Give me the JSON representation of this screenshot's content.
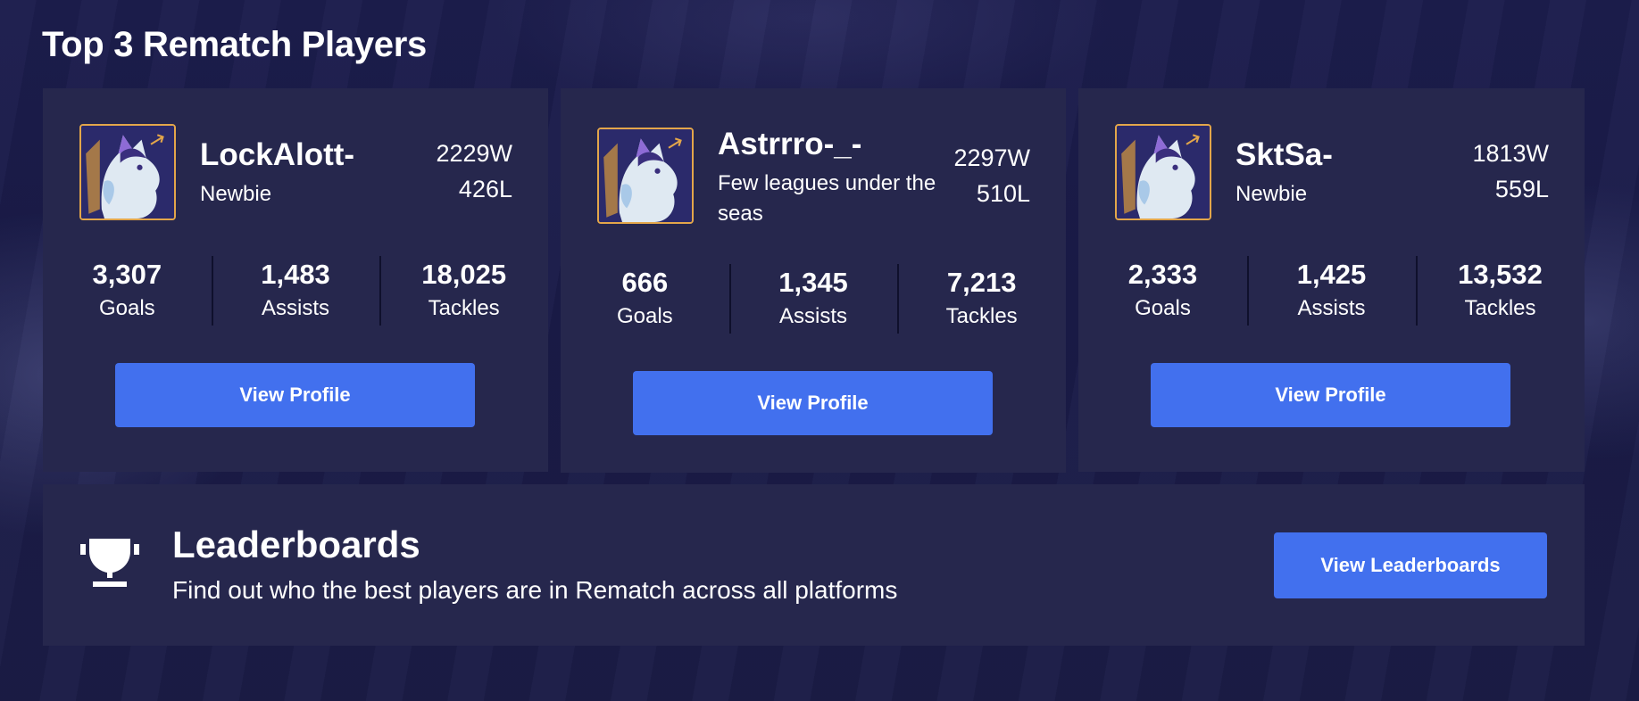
{
  "page_title": "Top 3 Rematch Players",
  "players": [
    {
      "name": "LockAlott-",
      "rank": "Newbie",
      "wins": "2229W",
      "losses": "426L",
      "stats": [
        {
          "value": "3,307",
          "label": "Goals"
        },
        {
          "value": "1,483",
          "label": "Assists"
        },
        {
          "value": "18,025",
          "label": "Tackles"
        }
      ],
      "button_label": "View Profile"
    },
    {
      "name": "Astrrro-_-",
      "rank": "Few leagues under the seas",
      "wins": "2297W",
      "losses": "510L",
      "stats": [
        {
          "value": "666",
          "label": "Goals"
        },
        {
          "value": "1,345",
          "label": "Assists"
        },
        {
          "value": "7,213",
          "label": "Tackles"
        }
      ],
      "button_label": "View Profile"
    },
    {
      "name": "SktSa-",
      "rank": "Newbie",
      "wins": "1813W",
      "losses": "559L",
      "stats": [
        {
          "value": "2,333",
          "label": "Goals"
        },
        {
          "value": "1,425",
          "label": "Assists"
        },
        {
          "value": "13,532",
          "label": "Tackles"
        }
      ],
      "button_label": "View Profile"
    }
  ],
  "leaderboards": {
    "icon": "trophy-icon",
    "title": "Leaderboards",
    "subtitle": "Find out who the best players are in Rematch across all platforms",
    "button_label": "View Leaderboards"
  },
  "colors": {
    "accent": "#4270ee",
    "card_bg": "#26274d",
    "avatar_border": "#e3a64a"
  }
}
